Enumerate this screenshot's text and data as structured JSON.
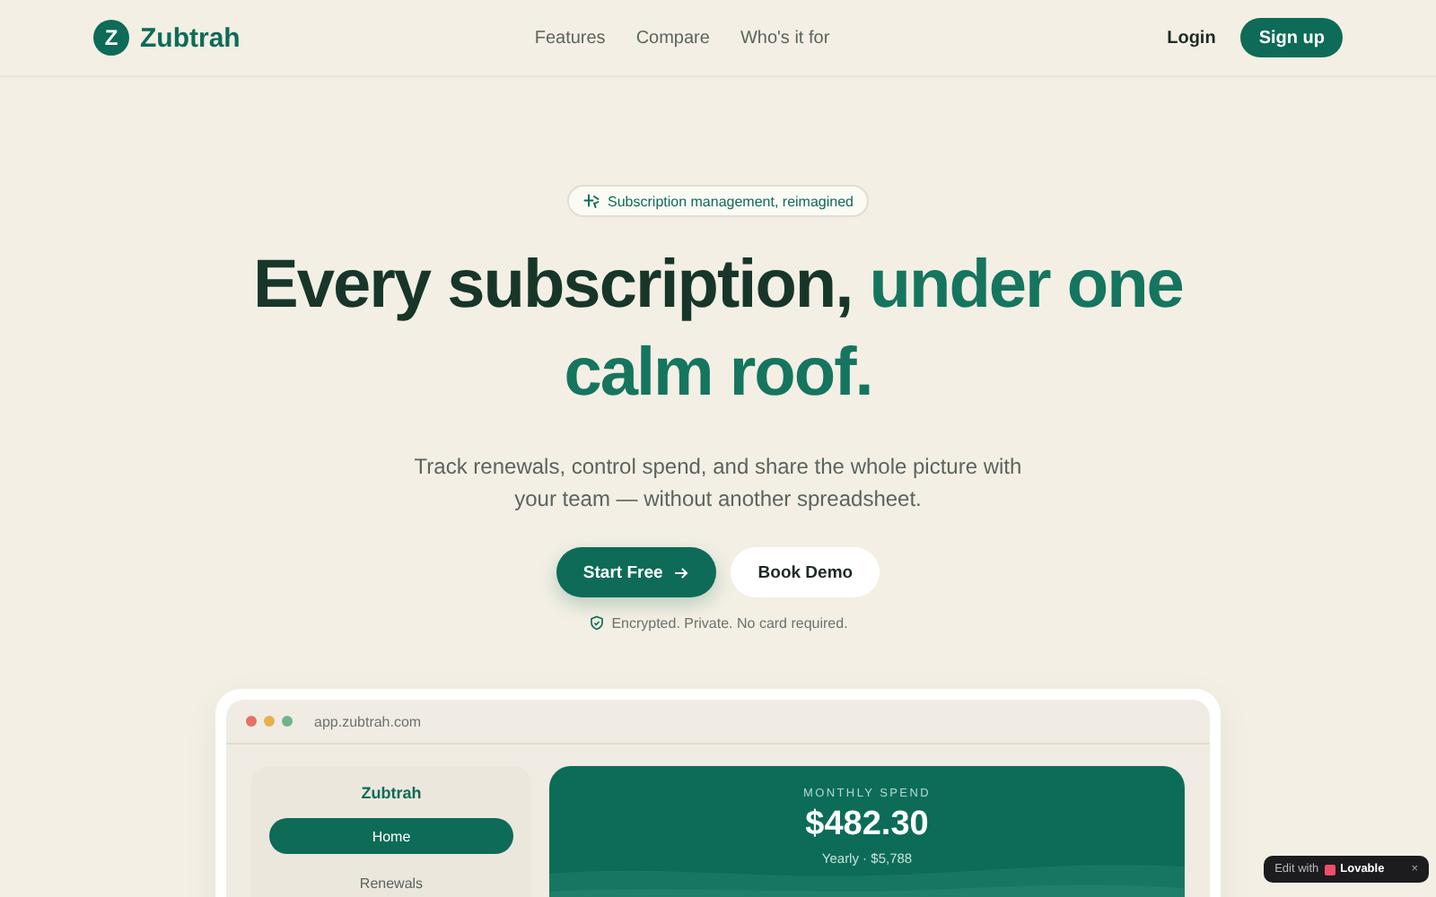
{
  "brand": {
    "letter": "Z",
    "name": "Zubtrah"
  },
  "nav": [
    "Features",
    "Compare",
    "Who's it for"
  ],
  "actions": {
    "login": "Login",
    "signup": "Sign up"
  },
  "hero": {
    "badge": "Subscription management, reimagined",
    "headline_lead": "Every subscription,",
    "headline_accent": "under one calm roof.",
    "subtitle": "Track renewals, control spend, and share the whole picture with your team — without another spreadsheet.",
    "primary": "Start Free",
    "secondary": "Book Demo",
    "note": "Encrypted. Private. No card required."
  },
  "preview": {
    "url": "app.zubtrah.com",
    "sidebar_title": "Zubtrah",
    "sidebar_items": [
      {
        "label": "Home",
        "selected": true
      },
      {
        "label": "Renewals",
        "selected": false
      }
    ],
    "spend": {
      "label": "MONTHLY SPEND",
      "amount": "$482.30",
      "yearly": "Yearly · $5,788"
    }
  },
  "builder_badge": {
    "prefix": "Edit with",
    "brand": "Lovable",
    "close": "×"
  }
}
